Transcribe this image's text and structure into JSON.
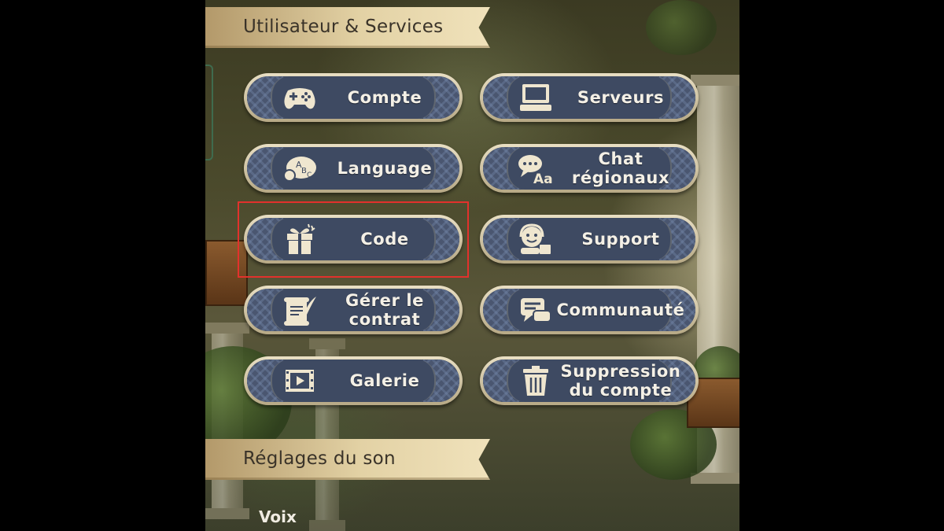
{
  "sections": {
    "user_services": "Utilisateur & Services",
    "sound_settings": "Réglages du son"
  },
  "buttons": {
    "account": {
      "label": "Compte",
      "icon": "gamepad-icon"
    },
    "servers": {
      "label": "Serveurs",
      "icon": "computer-icon"
    },
    "language": {
      "label": "Language",
      "icon": "language-bubble-icon"
    },
    "regional_chat": {
      "label": "Chat\nrégionaux",
      "icon": "chat-translate-icon"
    },
    "code": {
      "label": "Code",
      "icon": "gift-icon"
    },
    "support": {
      "label": "Support",
      "icon": "support-agent-icon"
    },
    "contract": {
      "label": "Gérer le\ncontrat",
      "icon": "scroll-quill-icon"
    },
    "community": {
      "label": "Communauté",
      "icon": "community-chat-icon"
    },
    "gallery": {
      "label": "Galerie",
      "icon": "film-play-icon"
    },
    "delete_account": {
      "label": "Suppression\ndu compte",
      "icon": "trash-icon"
    }
  },
  "sound": {
    "voice_label": "Voix"
  },
  "colors": {
    "button_face": "#3e4a62",
    "button_rim": "#e9dfc4",
    "header_gold": "#e3d2a5",
    "highlight": "#e2312c",
    "icon_cream": "#efe6cf"
  }
}
